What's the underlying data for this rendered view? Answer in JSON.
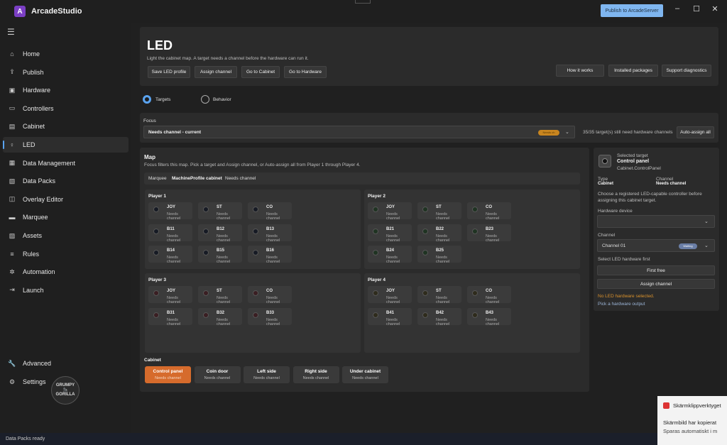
{
  "app": {
    "title": "ArcadeStudio",
    "publish_button": "Publish to ArcadeServer"
  },
  "sidebar": {
    "items": [
      {
        "label": "Home",
        "icon": "home-icon"
      },
      {
        "label": "Publish",
        "icon": "publish-icon"
      },
      {
        "label": "Hardware",
        "icon": "chip-icon"
      },
      {
        "label": "Controllers",
        "icon": "gamepad-icon"
      },
      {
        "label": "Cabinet",
        "icon": "cabinet-icon"
      },
      {
        "label": "LED",
        "icon": "lightbulb-icon"
      },
      {
        "label": "Data Management",
        "icon": "database-icon"
      },
      {
        "label": "Data Packs",
        "icon": "box-icon"
      },
      {
        "label": "Overlay Editor",
        "icon": "overlay-icon"
      },
      {
        "label": "Marquee",
        "icon": "marquee-icon"
      },
      {
        "label": "Assets",
        "icon": "image-icon"
      },
      {
        "label": "Rules",
        "icon": "rules-icon"
      },
      {
        "label": "Automation",
        "icon": "gear-icon"
      },
      {
        "label": "Launch",
        "icon": "launch-icon"
      }
    ],
    "advanced": "Advanced",
    "settings": "Settings",
    "brand_top": "GRUMPY",
    "brand_bottom": "GORILLA"
  },
  "header": {
    "title": "LED",
    "subtitle": "Light the cabinet map. A target needs a channel before the hardware can run it.",
    "buttons": [
      "Save LED profile",
      "Assign channel",
      "Go to Cabinet",
      "Go to Hardware"
    ],
    "right_buttons": [
      "How it works",
      "Installed packages",
      "Support diagnostics"
    ]
  },
  "mode": {
    "targets": "Targets",
    "behavior": "Behavior"
  },
  "focus": {
    "label": "Focus",
    "value": "Needs channel - current",
    "badge": "Needs ch",
    "status": "35/35 target(s) still need hardware channels",
    "auto_assign": "Auto-assign all"
  },
  "map": {
    "title": "Map",
    "hint": "Focus filters this map. Pick a target and Assign channel, or Auto-assign all from Player 1 through Player 4.",
    "crumbs": [
      "Marquee",
      "MachineProfile cabinet",
      "Needs channel"
    ],
    "players": [
      {
        "name": "Player 1",
        "targets": [
          "JOY",
          "ST",
          "CO",
          "B11",
          "B12",
          "B13",
          "B14",
          "B15",
          "B16"
        ]
      },
      {
        "name": "Player 2",
        "targets": [
          "JOY",
          "ST",
          "CO",
          "B21",
          "B22",
          "B23",
          "B24",
          "B25"
        ]
      },
      {
        "name": "Player 3",
        "targets": [
          "JOY",
          "ST",
          "CO",
          "B31",
          "B32",
          "B33"
        ]
      },
      {
        "name": "Player 4",
        "targets": [
          "JOY",
          "ST",
          "CO",
          "B41",
          "B42",
          "B43"
        ]
      }
    ],
    "needs_channel": "Needs channel",
    "cabinet_label": "Cabinet",
    "cabinet": [
      "Control panel",
      "Coin door",
      "Left side",
      "Right side",
      "Under cabinet"
    ]
  },
  "selected": {
    "heading": "Selected target",
    "name": "Control panel",
    "path": "Cabinet.ControlPanel",
    "type_label": "Type",
    "type_value": "Cabinet",
    "channel_label": "Channel",
    "channel_value": "Needs channel",
    "description": "Choose a registered LED-capable controller before assigning this cabinet target.",
    "hardware_label": "Hardware device",
    "hardware_value": "",
    "channel_field_label": "Channel",
    "channel_field_value": "Channel 01",
    "channel_badge": "Waiting",
    "select_hint": "Select LED hardware first",
    "first_free": "First free",
    "assign": "Assign channel",
    "warning": "No LED hardware selected.",
    "link": "Pick a hardware output"
  },
  "colors": {
    "accent": "#5aa3f0",
    "active_tile": "#d66b2c",
    "warning": "#d9912c",
    "badge": "#c8851f"
  },
  "status_bar": "Data Packs ready",
  "toast": {
    "app": "Skärmklippverktyget",
    "title": "Skärmbild har kopierat",
    "body": "Sparas automatiskt i m"
  }
}
